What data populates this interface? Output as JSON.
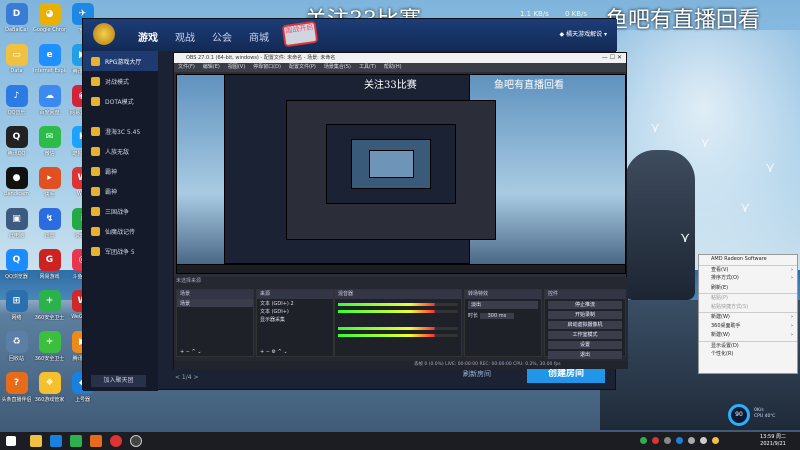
{
  "overlays": {
    "left_banner": "关注33比赛",
    "right_banner": "鱼吧有直播回看",
    "stat1": "1.1 KB/s",
    "stat2": "0 KB/s"
  },
  "desktop_icons": [
    {
      "label": "DaBaiCai",
      "color": "#3a7bd5",
      "glyph": "D"
    },
    {
      "label": "Google Chrome",
      "color": "#e8b000",
      "glyph": "◕"
    },
    {
      "label": "飞书",
      "color": "#1e88e5",
      "glyph": "✈"
    },
    {
      "label": "Data",
      "color": "#f0c040",
      "glyph": "▭"
    },
    {
      "label": "Internet Explorer",
      "color": "#1e90ff",
      "glyph": "e"
    },
    {
      "label": "腾讯课堂",
      "color": "#21a0e8",
      "glyph": "▶"
    },
    {
      "label": "QQ音乐",
      "color": "#2c7be5",
      "glyph": "♪"
    },
    {
      "label": "百度网盘",
      "color": "#3c8af0",
      "glyph": "☁"
    },
    {
      "label": "网易云音乐",
      "color": "#d0243a",
      "glyph": "◉"
    },
    {
      "label": "腾讯QQ",
      "color": "#222",
      "glyph": "Q"
    },
    {
      "label": "微信",
      "color": "#2dbb4a",
      "glyph": "✉"
    },
    {
      "label": "酷狗音乐",
      "color": "#1aa3ff",
      "glyph": "K"
    },
    {
      "label": "Bandicam",
      "color": "#111",
      "glyph": "●"
    },
    {
      "label": "快手",
      "color": "#e05020",
      "glyph": "▸"
    },
    {
      "label": "WPS",
      "color": "#d33",
      "glyph": "W"
    },
    {
      "label": "此电脑",
      "color": "#3d5a80",
      "glyph": "▣"
    },
    {
      "label": "迅雷",
      "color": "#2b6de0",
      "glyph": "↯"
    },
    {
      "label": "爱奇艺",
      "color": "#22aa44",
      "glyph": "i"
    },
    {
      "label": "QQ浏览器",
      "color": "#1a8cff",
      "glyph": "Q"
    },
    {
      "label": "网易游戏",
      "color": "#c22",
      "glyph": "G"
    },
    {
      "label": "斗鱼直播",
      "color": "#e8364f",
      "glyph": "◎"
    },
    {
      "label": "网络",
      "color": "#2a6fb0",
      "glyph": "⊞"
    },
    {
      "label": "360安全卫士",
      "color": "#2bb24c",
      "glyph": "+"
    },
    {
      "label": "WeGame",
      "color": "#d02828",
      "glyph": "W"
    },
    {
      "label": "回收站",
      "color": "#5b7fa6",
      "glyph": "♻"
    },
    {
      "label": "360安全卫士",
      "color": "#3cbf3c",
      "glyph": "+"
    },
    {
      "label": "腾讯视频",
      "color": "#ee8a1a",
      "glyph": "▶"
    },
    {
      "label": "头条直播伴侣",
      "color": "#e86b1c",
      "glyph": "?"
    },
    {
      "label": "360游戏管家",
      "color": "#f4c030",
      "glyph": "❖"
    },
    {
      "label": "上号器",
      "color": "#1a80e0",
      "glyph": "◆"
    }
  ],
  "platform": {
    "tabs": [
      "游戏",
      "观战",
      "公会",
      "商城"
    ],
    "stamp": "国战开启",
    "user": "◆ 橘天游戏解说 ▾",
    "sidebar": [
      "RPG游戏大厅",
      "对战模式",
      "DOTA模式",
      "澄海3C 5.45",
      "人族无敌",
      "霸神",
      "霸神",
      "三国战争",
      "仙魔战记传",
      "军团战争 5"
    ],
    "join": "加入聚天团",
    "create_room": "创建房间",
    "refresh": "刷新房间",
    "pager": "< 1/4 >"
  },
  "obs": {
    "title": "OBS 27.0.1 (64-bit, windows) - 配置文件: 未命名 - 场景: 未命名",
    "menu": [
      "文件(F)",
      "编辑(E)",
      "视图(V)",
      "停靠窗口(D)",
      "配置文件(P)",
      "场景集合(S)",
      "工具(T)",
      "帮助(H)"
    ],
    "preview_banner_left": "关注33比赛",
    "preview_banner_right": "鱼吧有直播回看",
    "docks": {
      "scenes_header": "场景",
      "sources_header": "来源",
      "mixer_header": "混音器",
      "transitions_header": "转场特效",
      "controls_header": "控件",
      "no_source": "未选择来源",
      "scene_item": "场景",
      "sources": [
        "文本 (GDI+) 2",
        "文本 (GDI+)",
        "显示器采集"
      ],
      "transition": "淡出",
      "duration_label": "时长",
      "duration": "300 ms",
      "controls": [
        "停止推流",
        "开始录制",
        "启动虚拟摄像机",
        "工作室模式",
        "设置",
        "退出"
      ]
    },
    "status": "丢帧 0 (0.0%)    LIVE: 00:00:00    REC: 00:00:00    CPU: 0.2%, 30.00 fps"
  },
  "context_menu": [
    {
      "label": "AMD Radeon Software",
      "arrow": false,
      "disabled": false
    },
    {
      "label": "查看(V)",
      "arrow": true,
      "disabled": false
    },
    {
      "label": "排序方式(O)",
      "arrow": true,
      "disabled": false
    },
    {
      "label": "刷新(E)",
      "arrow": false,
      "disabled": false
    },
    {
      "label": "粘贴(P)",
      "arrow": false,
      "disabled": true
    },
    {
      "label": "粘贴快捷方式(S)",
      "arrow": false,
      "disabled": true
    },
    {
      "label": "新建(W)",
      "arrow": true,
      "disabled": false
    },
    {
      "label": "360桌面助手",
      "arrow": true,
      "disabled": false
    },
    {
      "label": "新建(W)",
      "arrow": true,
      "disabled": false
    },
    {
      "label": "显示设置(D)",
      "arrow": false,
      "disabled": false
    },
    {
      "label": "个性化(R)",
      "arrow": false,
      "disabled": false
    }
  ],
  "widget": {
    "value": "90",
    "line1": "0K/s",
    "line2": "CPU 40℃"
  },
  "taskbar": {
    "time": "13:59 周二",
    "date": "2021/9/21"
  }
}
